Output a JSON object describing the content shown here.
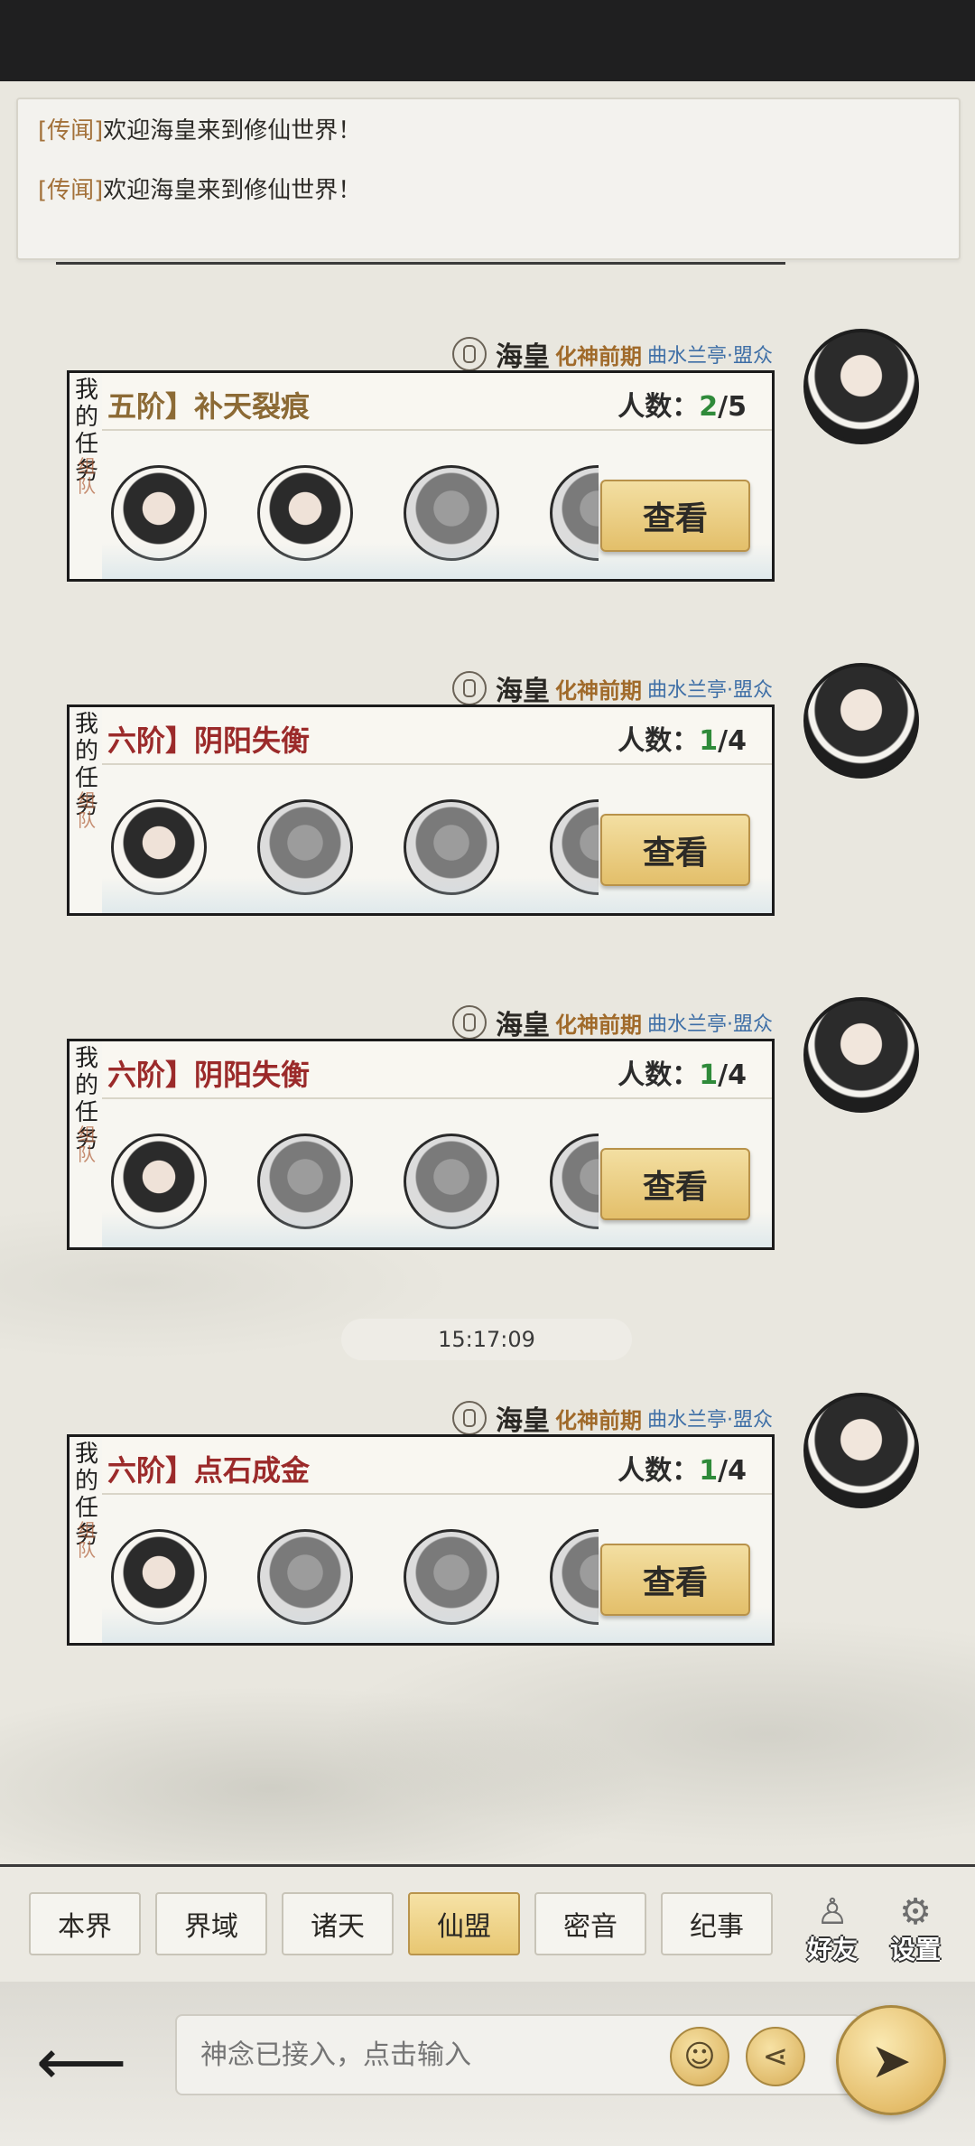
{
  "news": [
    {
      "tag": "[传闻]",
      "text": "欢迎海皇来到修仙世界！"
    },
    {
      "tag": "[传闻]",
      "text": "欢迎海皇来到修仙世界！"
    }
  ],
  "messages": [
    {
      "sender": "海皇",
      "rank": "化神前期",
      "guild": "曲水兰亭·盟众",
      "card": {
        "side_label": "我的任务",
        "stamp": "组队",
        "title": "五阶】补天裂痕",
        "count_label": "人数：",
        "count_current": "2",
        "count_total": "/5",
        "button": "查看"
      }
    },
    {
      "sender": "海皇",
      "rank": "化神前期",
      "guild": "曲水兰亭·盟众",
      "card": {
        "side_label": "我的任务",
        "stamp": "组队",
        "title": "六阶】阴阳失衡",
        "count_label": "人数：",
        "count_current": "1",
        "count_total": "/4",
        "button": "查看"
      }
    },
    {
      "sender": "海皇",
      "rank": "化神前期",
      "guild": "曲水兰亭·盟众",
      "card": {
        "side_label": "我的任务",
        "stamp": "组队",
        "title": "六阶】阴阳失衡",
        "count_label": "人数：",
        "count_current": "1",
        "count_total": "/4",
        "button": "查看"
      }
    },
    {
      "sender": "海皇",
      "rank": "化神前期",
      "guild": "曲水兰亭·盟众",
      "card": {
        "side_label": "我的任务",
        "stamp": "组队",
        "title": "六阶】点石成金",
        "count_label": "人数：",
        "count_current": "1",
        "count_total": "/4",
        "button": "查看"
      }
    }
  ],
  "timestamp": "15:17:09",
  "tabs": [
    {
      "label": "本界",
      "active": false
    },
    {
      "label": "界域",
      "active": false
    },
    {
      "label": "诸天",
      "active": false
    },
    {
      "label": "仙盟",
      "active": true
    },
    {
      "label": "密音",
      "active": false
    },
    {
      "label": "纪事",
      "active": false
    }
  ],
  "side_buttons": {
    "friends": "好友",
    "settings": "设置"
  },
  "input": {
    "placeholder": "神念已接入，点击输入"
  },
  "colors": {
    "accent_gold": "#e3bf6a",
    "rank": "#a06a2a",
    "guild": "#3d6ea6",
    "count_current": "#2f8a3a",
    "title_5": "#8c6a35",
    "title_6": "#9b2a2a"
  }
}
